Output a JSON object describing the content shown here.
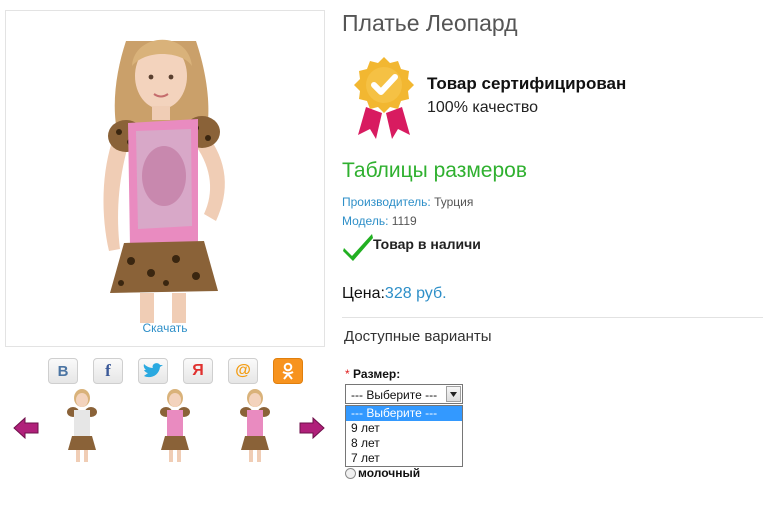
{
  "product": {
    "title": "Платье Леопард",
    "download_label": "Скачать"
  },
  "certificate": {
    "title": "Товар сертифицирован",
    "subtitle": "100% качество",
    "badge_color": "#f2b731",
    "ribbon_color": "#d81b60"
  },
  "size_tables_link": "Таблицы размеров",
  "specs": {
    "manufacturer_label": "Производитель:",
    "manufacturer_value": "Турция",
    "model_label": "Модель:",
    "model_value": "1119"
  },
  "stock": {
    "text": "Товар в наличи",
    "check_color": "#22b022"
  },
  "price": {
    "label": "Цена:",
    "value": "328 руб."
  },
  "variants": {
    "title": "Доступные варианты",
    "size_label": "Размер:",
    "required_mark": "*",
    "selected": "--- Выберите ---",
    "options": [
      "--- Выберите ---",
      "9 лет",
      "8 лет",
      "7 лет"
    ],
    "color_option": "молочный"
  },
  "social": [
    "vk-icon",
    "facebook-icon",
    "twitter-icon",
    "yaru-icon",
    "mailru-icon",
    "odnoklassniki-icon"
  ],
  "colors": {
    "accent": "#2e8fc8",
    "green": "#2fb02f",
    "arrow": "#b0207a"
  }
}
